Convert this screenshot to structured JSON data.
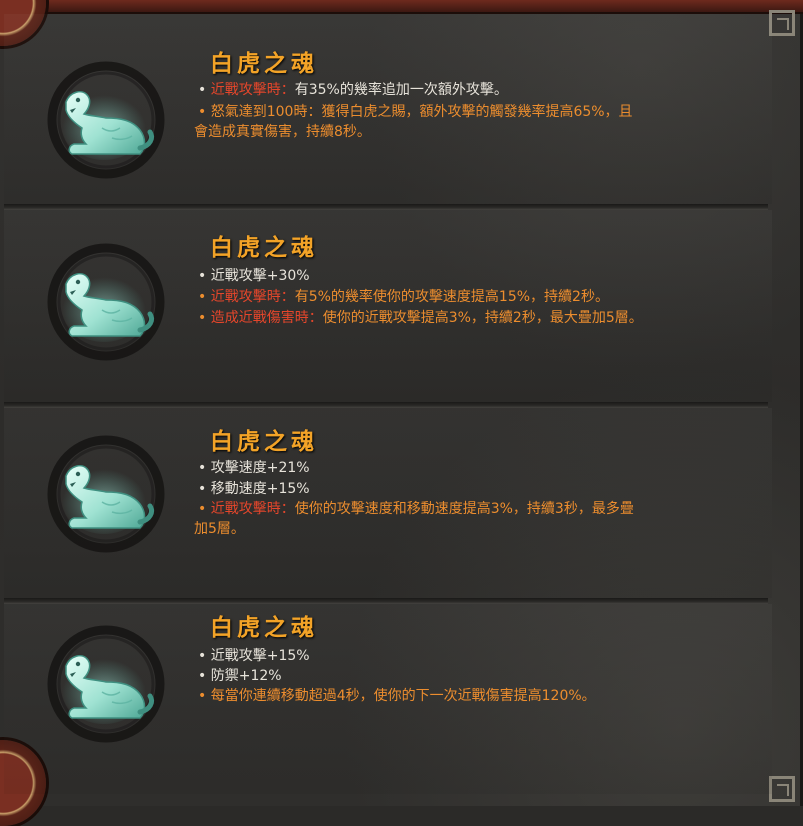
{
  "colors": {
    "title": "#f3a327",
    "trigger_label": "#e5462b",
    "orange_text": "#ec8d2e",
    "white_text": "#e7e3da",
    "accent_red": "#7a2f22"
  },
  "bullet": "•",
  "panels": [
    {
      "icon": "white-tiger-icon",
      "title": "白虎之魂",
      "lines": [
        {
          "style": "mixed",
          "label": "近戰攻擊時：",
          "text": "有35%的幾率追加一次額外攻擊。"
        },
        {
          "style": "orange",
          "text": "怒氣達到100時：獲得白虎之賜，額外攻擊的觸發幾率提高65%，且"
        },
        {
          "style": "orange-cont",
          "text": "會造成",
          "tail": "真實傷害，持續8秒。"
        }
      ]
    },
    {
      "icon": "white-tiger-icon",
      "title": "白虎之魂",
      "lines": [
        {
          "style": "white",
          "text": "近戰攻擊+30%"
        },
        {
          "style": "mixed",
          "label": "近戰攻擊時：",
          "text": "有5%的幾率使你的攻擊速度提高15%，持續2秒。"
        },
        {
          "style": "mixed",
          "label": "造成近戰傷害時：",
          "text": "使你的近戰攻擊提高3%，持續2秒，最大疊加5層。"
        }
      ]
    },
    {
      "icon": "white-tiger-icon",
      "title": "白虎之魂",
      "lines": [
        {
          "style": "white",
          "text": "攻擊速度+21%"
        },
        {
          "style": "white",
          "text": "移動速度+15%"
        },
        {
          "style": "mixed",
          "label": "近戰攻擊時：",
          "text": "使你的攻擊速度和移動速度提高3%，持續3秒，最多疊"
        },
        {
          "style": "orange-cont",
          "text": "加5層。"
        }
      ]
    },
    {
      "icon": "white-tiger-icon",
      "title": "白虎之魂",
      "lines": [
        {
          "style": "white",
          "text": "近戰攻擊+15%"
        },
        {
          "style": "white",
          "text": "防禦+12%"
        },
        {
          "style": "orange",
          "text": "每當你連續移動超過4秒，使你的下一次近戰傷害提高120%。"
        }
      ]
    }
  ]
}
